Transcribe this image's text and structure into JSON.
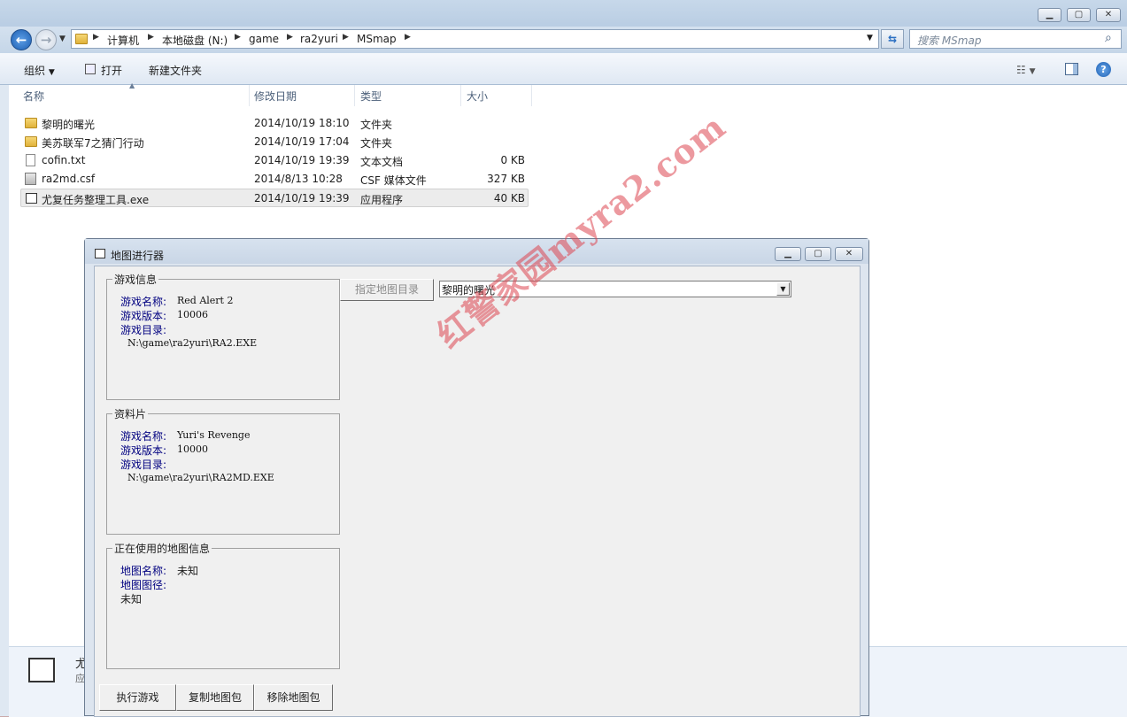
{
  "explorer": {
    "breadcrumb": [
      "计算机",
      "本地磁盘 (N:)",
      "game",
      "ra2yuri",
      "MSmap"
    ],
    "search_placeholder": "搜索 MSmap",
    "toolbar": {
      "organize": "组织",
      "open": "打开",
      "new_folder": "新建文件夹"
    },
    "columns": {
      "name": "名称",
      "modified": "修改日期",
      "type": "类型",
      "size": "大小"
    },
    "files": [
      {
        "name": "黎明的曙光",
        "modified": "2014/10/19 18:10",
        "type": "文件夹",
        "size": "",
        "icon": "folder-icon"
      },
      {
        "name": "美苏联军7之猜门行动",
        "modified": "2014/10/19 17:04",
        "type": "文件夹",
        "size": "",
        "icon": "folder-icon"
      },
      {
        "name": "cofin.txt",
        "modified": "2014/10/19 19:39",
        "type": "文本文档",
        "size": "0 KB",
        "icon": "text-file-icon"
      },
      {
        "name": "ra2md.csf",
        "modified": "2014/8/13 10:28",
        "type": "CSF 媒体文件",
        "size": "327 KB",
        "icon": "media-file-icon"
      },
      {
        "name": "尤复任务整理工具.exe",
        "modified": "2014/10/19 19:39",
        "type": "应用程序",
        "size": "40 KB",
        "icon": "exe-icon"
      }
    ],
    "details_name": "尤",
    "details_type": "应"
  },
  "dialog": {
    "title": "地图进行器",
    "game_info": {
      "title": "游戏信息",
      "name_label": "游戏名称:",
      "name_value": "Red Alert 2",
      "version_label": "游戏版本:",
      "version_value": "10006",
      "dir_label": "游戏目录:",
      "dir_value": "N:\\game\\ra2yuri\\RA2.EXE"
    },
    "expansion": {
      "title": "资料片",
      "name_label": "游戏名称:",
      "name_value": "Yuri's Revenge",
      "version_label": "游戏版本:",
      "version_value": "10000",
      "dir_label": "游戏目录:",
      "dir_value": "N:\\game\\ra2yuri\\RA2MD.EXE"
    },
    "map_info": {
      "title": "正在使用的地图信息",
      "name_label": "地图名称:",
      "name_value": "未知",
      "path_label": "地图图径:",
      "path_value": "未知"
    },
    "dir_button": "指定地图目录",
    "map_select_value": "黎明的曙光",
    "run_button": "执行游戏",
    "copy_button": "复制地图包",
    "remove_button": "移除地图包"
  },
  "watermark": "红警家园myra2.com"
}
